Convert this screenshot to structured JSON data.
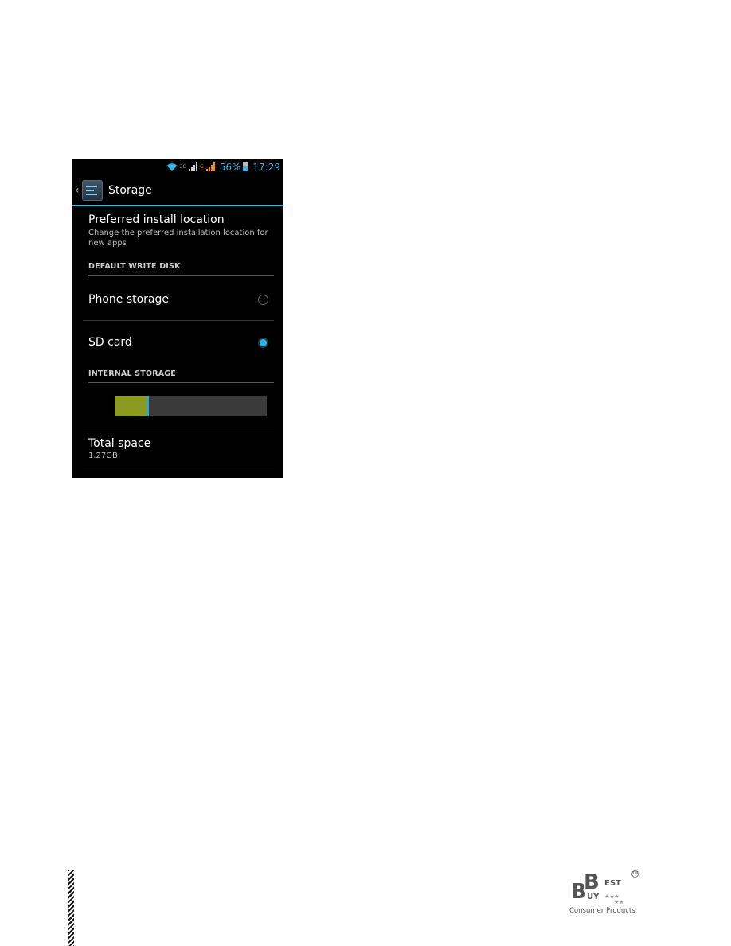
{
  "status_bar": {
    "network_3g_label": "3G",
    "network_g_label": "G",
    "battery_percent": "56%",
    "battery_level": 0.56,
    "time": "17:29",
    "icons": [
      "wifi-icon",
      "signal-icon",
      "signal-icon",
      "battery-icon"
    ]
  },
  "action_bar": {
    "back_icon": "chevron-left-icon",
    "app_icon": "settings-storage-icon",
    "title": "Storage"
  },
  "preferred_install": {
    "title": "Preferred install location",
    "summary": "Change the preferred installation location for new apps"
  },
  "default_write_disk": {
    "header": "DEFAULT WRITE DISK",
    "options": [
      {
        "label": "Phone storage",
        "selected": false
      },
      {
        "label": "SD card",
        "selected": true
      }
    ]
  },
  "internal_storage": {
    "header": "INTERNAL STORAGE",
    "usage_bar": {
      "used_fraction": 0.21,
      "other_fraction": 0.015,
      "colors": {
        "used": "#8c9a22",
        "other": "#33a5c5",
        "free": "#3a3a3a"
      }
    },
    "total_space": {
      "title": "Total space",
      "value": "1.27GB"
    }
  },
  "footer": {
    "logo": {
      "big_letters": [
        "B",
        "B"
      ],
      "word_top": "EST",
      "word_bottom": "UY",
      "trademark": "TM",
      "tagline": "Consumer Products"
    }
  },
  "colors": {
    "accent": "#33b5e5",
    "background": "#000000"
  }
}
